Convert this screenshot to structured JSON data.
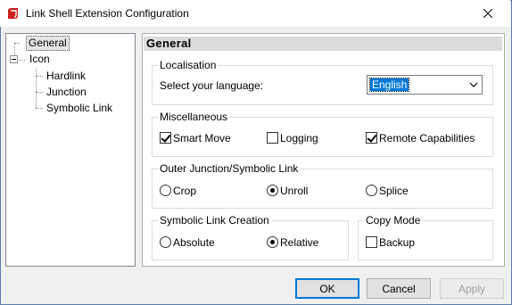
{
  "window": {
    "title": "Link Shell Extension Configuration"
  },
  "tree": {
    "items": [
      {
        "label": "General"
      },
      {
        "label": "Icon"
      },
      {
        "label": "Hardlink"
      },
      {
        "label": "Junction"
      },
      {
        "label": "Symbolic Link"
      }
    ]
  },
  "page": {
    "title": "General",
    "localisation": {
      "legend": "Localisation",
      "language_label": "Select your language:",
      "language_value": "English"
    },
    "misc": {
      "legend": "Miscellaneous",
      "options": [
        {
          "label": "Smart Move",
          "checked": true
        },
        {
          "label": "Logging",
          "checked": false
        },
        {
          "label": "Remote Capabilities",
          "checked": true
        }
      ]
    },
    "outer_junction": {
      "legend": "Outer Junction/Symbolic Link",
      "options": [
        {
          "label": "Crop",
          "selected": false
        },
        {
          "label": "Unroll",
          "selected": true
        },
        {
          "label": "Splice",
          "selected": false
        }
      ]
    },
    "symlink_creation": {
      "legend": "Symbolic Link Creation",
      "options": [
        {
          "label": "Absolute",
          "selected": false
        },
        {
          "label": "Relative",
          "selected": true
        }
      ]
    },
    "copy_mode": {
      "legend": "Copy Mode",
      "options": [
        {
          "label": "Backup",
          "checked": false
        }
      ]
    }
  },
  "buttons": {
    "ok": "OK",
    "cancel": "Cancel",
    "apply": "Apply"
  },
  "icons": {
    "app": "link-shell-app-icon",
    "close": "close-icon",
    "dropdown": "chevron-down-icon"
  },
  "colors": {
    "selection": "#0078d7",
    "default_button_border": "#0078d7",
    "panel_header": "#dcdcdc"
  }
}
